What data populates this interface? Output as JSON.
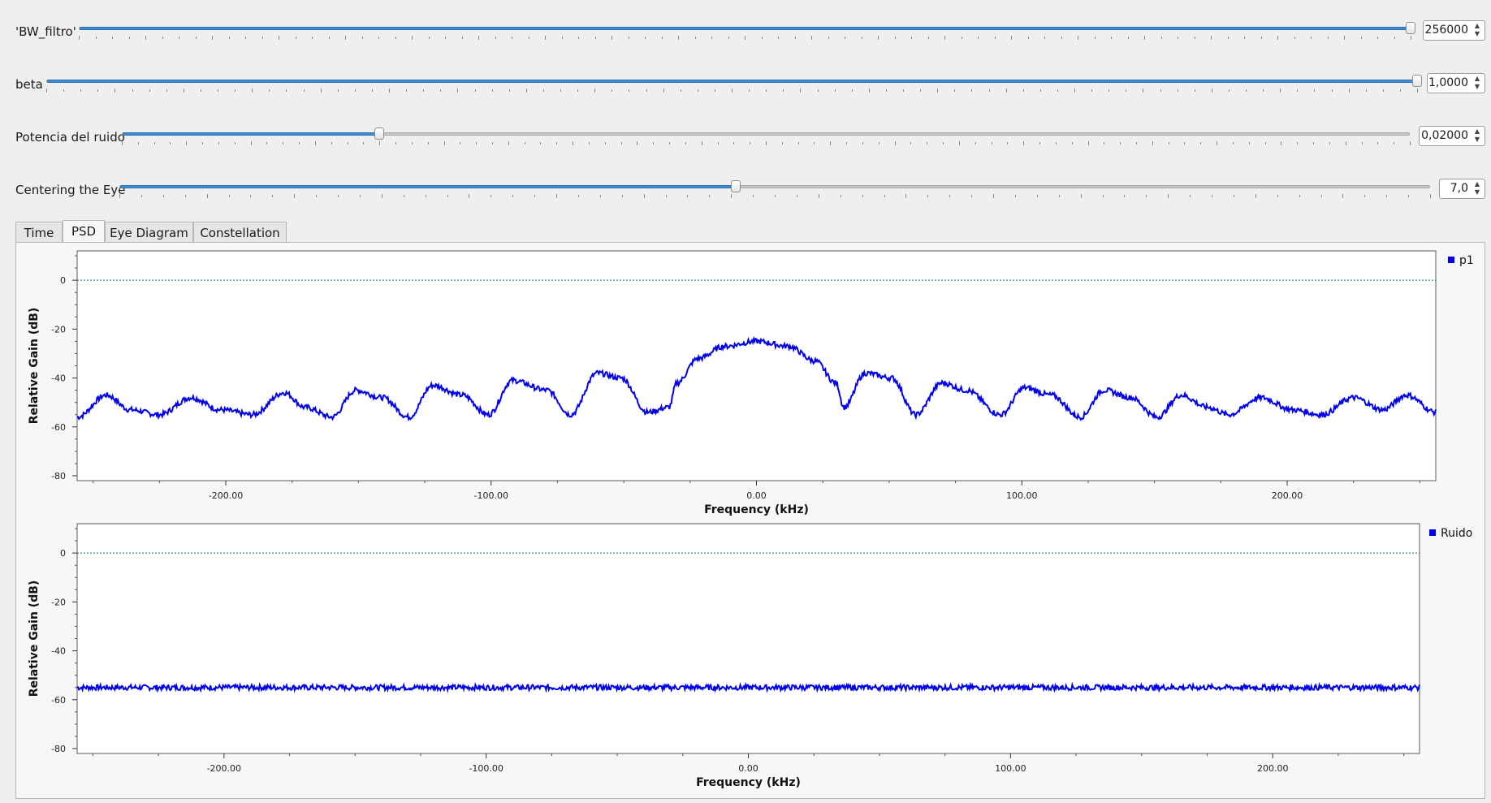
{
  "sliders": [
    {
      "label": "'BW_filtro'",
      "value": "256000",
      "fraction": 1.0
    },
    {
      "label": "beta",
      "value": "1,0000",
      "fraction": 1.0
    },
    {
      "label": "Potencia del ruido",
      "value": "0,02000",
      "fraction": 0.2
    },
    {
      "label": "Centering the Eye",
      "value": "7,0",
      "fraction": 0.47
    }
  ],
  "tabs": [
    "Time",
    "PSD",
    "Eye Diagram",
    "Constellation"
  ],
  "active_tab": "PSD",
  "colors": {
    "trace": "#0000ee",
    "reference_line": "#0a6b6b",
    "slider_fill": "#3c8fd6"
  },
  "chart_data": [
    {
      "type": "line",
      "xlabel": "Frequency (kHz)",
      "ylabel": "Relative Gain (dB)",
      "xlim": [
        -256,
        256
      ],
      "ylim": [
        -82,
        12
      ],
      "x_ticks": [
        "-200.00",
        "-100.00",
        "0.00",
        "100.00",
        "200.00"
      ],
      "y_ticks": [
        "0",
        "-20",
        "-40",
        "-60",
        "-80"
      ],
      "reference_line_y": 0,
      "legend": "top-right",
      "series": [
        {
          "name": "p1",
          "x": [
            -256,
            -245,
            -236,
            -225,
            -213,
            -202,
            -190,
            -178,
            -170,
            -160,
            -151,
            -141,
            -131,
            -122,
            -111,
            -101,
            -92,
            -79,
            -70,
            -60,
            -51,
            -41,
            -33,
            -30,
            -22,
            -12,
            0,
            12,
            22,
            30,
            33,
            41,
            51,
            60,
            70,
            79,
            92,
            101,
            111,
            122,
            131,
            141,
            151,
            160,
            170,
            178,
            190,
            202,
            213,
            225,
            236,
            245,
            256
          ],
          "y": [
            -56,
            -47,
            -53,
            -55,
            -48,
            -53,
            -55,
            -46,
            -52,
            -56,
            -45,
            -48,
            -56,
            -43,
            -47,
            -55,
            -41,
            -45,
            -55,
            -38,
            -40,
            -54,
            -52,
            -42,
            -32,
            -27,
            -25,
            -27,
            -33,
            -42,
            -52,
            -38,
            -40,
            -55,
            -42,
            -45,
            -55,
            -44,
            -47,
            -56,
            -45,
            -48,
            -56,
            -47,
            -52,
            -55,
            -48,
            -53,
            -55,
            -48,
            -53,
            -47,
            -54
          ]
        }
      ]
    },
    {
      "type": "line",
      "xlabel": "Frequency (kHz)",
      "ylabel": "Relative Gain (dB)",
      "xlim": [
        -256,
        256
      ],
      "ylim": [
        -82,
        12
      ],
      "x_ticks": [
        "-200.00",
        "-100.00",
        "0.00",
        "100.00",
        "200.00"
      ],
      "y_ticks": [
        "0",
        "-20",
        "-40",
        "-60",
        "-80"
      ],
      "reference_line_y": 0,
      "legend": "top-right",
      "series": [
        {
          "name": "Ruido",
          "x": [
            -256,
            -200,
            -150,
            -100,
            -50,
            0,
            50,
            100,
            150,
            200,
            256
          ],
          "y": [
            -55,
            -55,
            -55,
            -55,
            -55,
            -55,
            -55,
            -55,
            -55,
            -55,
            -55
          ]
        }
      ]
    }
  ]
}
